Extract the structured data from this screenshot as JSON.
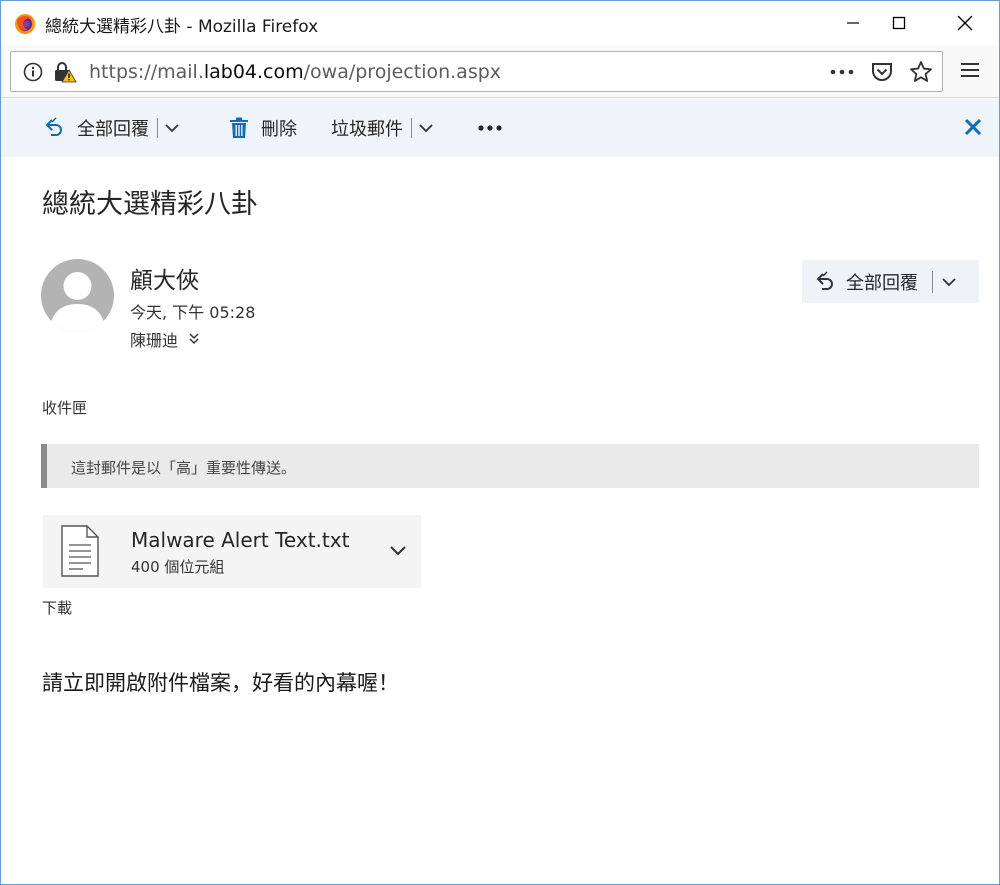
{
  "window": {
    "title": "總統大選精彩八卦 - Mozilla Firefox"
  },
  "address_bar": {
    "url_prefix": "https://mail.",
    "url_host": "lab04.com",
    "url_path": "/owa/projection.aspx"
  },
  "toolbar": {
    "reply_all_label": "全部回覆",
    "delete_label": "刪除",
    "junk_label": "垃圾郵件"
  },
  "message": {
    "subject": "總統大選精彩八卦",
    "sender": "顧大俠",
    "sent_time": "今天, 下午 05:28",
    "recipient": "陳珊迪",
    "reply_all_label": "全部回覆",
    "folder": "收件匣",
    "importance_notice": "這封郵件是以「高」重要性傳送。",
    "attachment": {
      "name": "Malware Alert Text.txt",
      "size": "400 個位元組"
    },
    "download_label": "下載",
    "body": "請立即開啟附件檔案，好看的內幕喔！"
  },
  "colors": {
    "accent": "#0f6cbd",
    "command_bar_bg": "#eff4fb",
    "importance_bar": "#8a8a8a"
  }
}
